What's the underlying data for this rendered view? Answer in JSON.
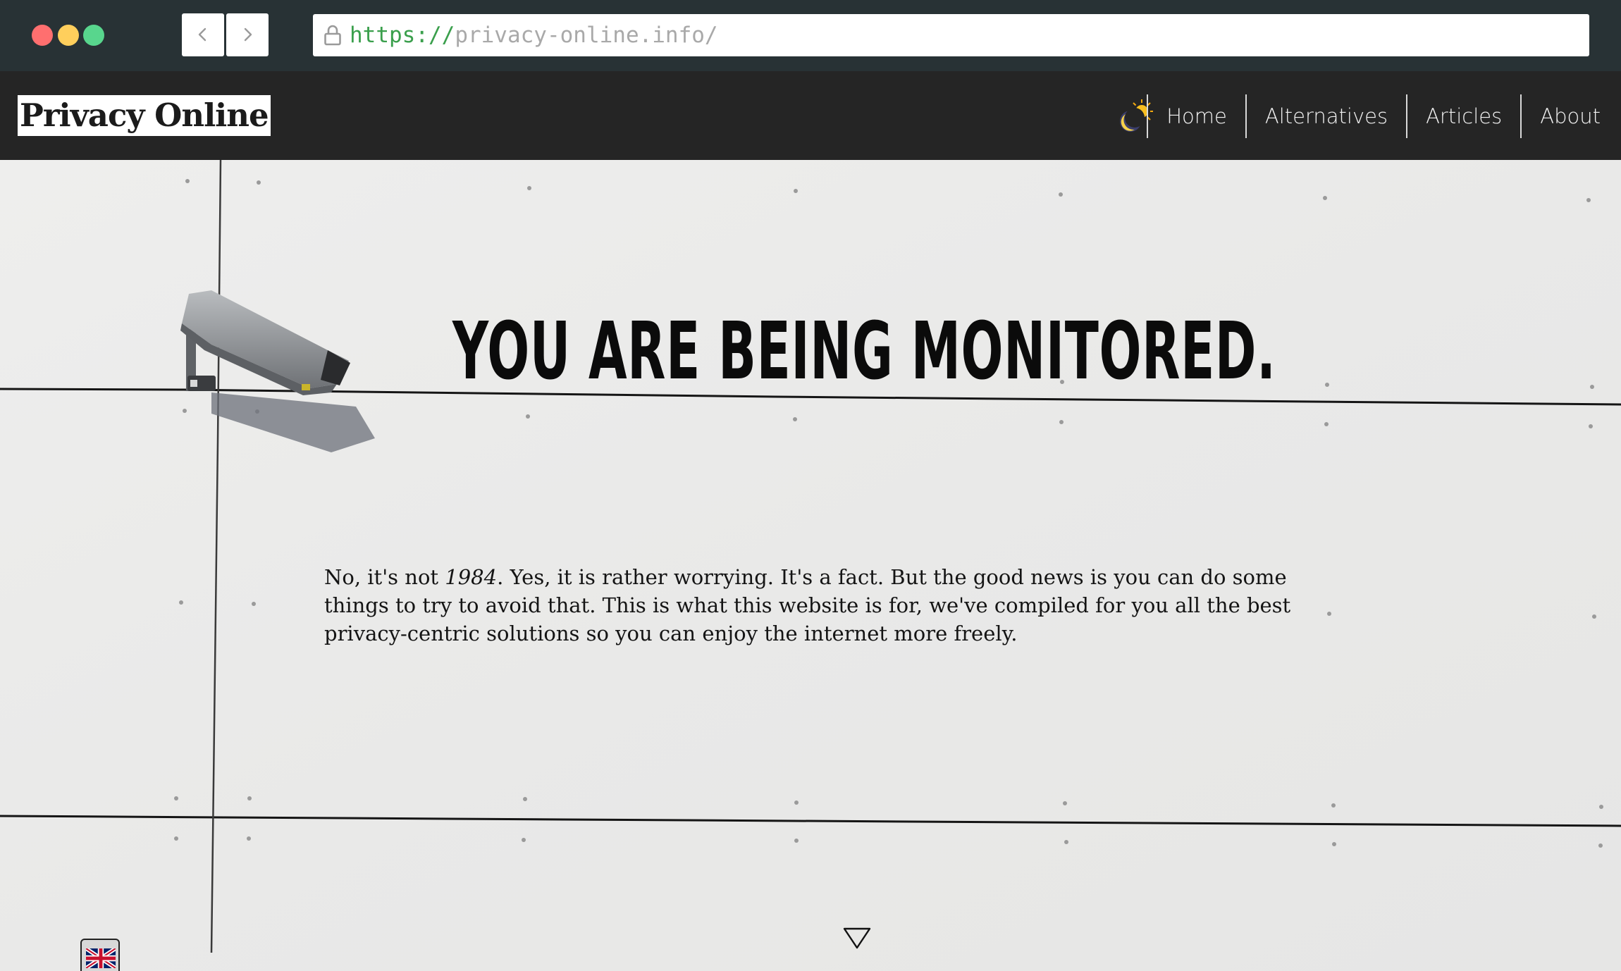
{
  "browser": {
    "url_scheme": "https://",
    "url_host": "privacy-online.info/",
    "back_label": "Back",
    "forward_label": "Forward"
  },
  "site": {
    "logo": "Privacy Online",
    "theme_toggle_icon": "moon-sun-icon",
    "nav": {
      "items": [
        {
          "label": "Home"
        },
        {
          "label": "Alternatives"
        },
        {
          "label": "Articles"
        },
        {
          "label": "About"
        }
      ]
    }
  },
  "hero": {
    "headline": "YOU ARE BEING MONITORED.",
    "intro_before": "No, it's not ",
    "intro_em": "1984",
    "intro_after": ". Yes, it is rather worrying. It's a fact. But the good news is you can do some things to try to avoid that. This is what this website is for, we've compiled for you all the best privacy-centric solutions so you can enjoy the internet more freely.",
    "scroll_icon": "triangle-down-icon",
    "language_icon": "uk-flag-icon"
  },
  "colors": {
    "chrome_bg": "#283235",
    "header_bg": "#252525",
    "url_scheme": "#3a9f4c",
    "url_host": "#a9a9a9",
    "hero_bg": "#ebebea",
    "headline": "#0b0b0b"
  }
}
